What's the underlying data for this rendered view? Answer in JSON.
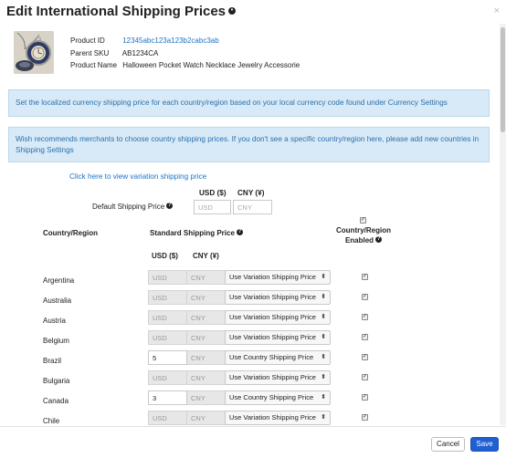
{
  "modal": {
    "title": "Edit International Shipping Prices",
    "close_glyph": "×",
    "help_icon": "info-circle-icon"
  },
  "product": {
    "id_label": "Product ID",
    "id_value": "12345abc123a123b2cabc3ab",
    "parent_sku_label": "Parent SKU",
    "parent_sku_value": "AB1234CA",
    "name_label": "Product Name",
    "name_value": "Halloween Pocket Watch Necklace Jewelry Accessorie"
  },
  "alerts": {
    "currency_notice": "Set the localized currency shipping price for each country/region based on your local currency code found under Currency Settings",
    "recommend_notice": "Wish recommends merchants to choose country shipping prices. If you don't see a specific country/region here, please add new countries in Shipping Settings"
  },
  "variation_link": "Click here to view variation shipping price",
  "default_price": {
    "label": "Default Shipping Price",
    "usd_header": "USD ($)",
    "cny_header": "CNY (¥)",
    "usd_placeholder": "USD",
    "cny_placeholder": "CNY"
  },
  "table": {
    "col_country": "Country/Region",
    "col_standard": "Standard Shipping Price",
    "col_enabled": "Country/Region Enabled",
    "usd_header": "USD ($)",
    "cny_header": "CNY (¥)",
    "rows": [
      {
        "country": "Argentina",
        "usd_value": "",
        "usd_placeholder": "USD",
        "cny_placeholder": "CNY",
        "option": "Use Variation Shipping Price",
        "enabled": true
      },
      {
        "country": "Australia",
        "usd_value": "",
        "usd_placeholder": "USD",
        "cny_placeholder": "CNY",
        "option": "Use Variation Shipping Price",
        "enabled": true
      },
      {
        "country": "Austria",
        "usd_value": "",
        "usd_placeholder": "USD",
        "cny_placeholder": "CNY",
        "option": "Use Variation Shipping Price",
        "enabled": true
      },
      {
        "country": "Belgium",
        "usd_value": "",
        "usd_placeholder": "USD",
        "cny_placeholder": "CNY",
        "option": "Use Variation Shipping Price",
        "enabled": true
      },
      {
        "country": "Brazil",
        "usd_value": "5",
        "usd_placeholder": "USD",
        "cny_placeholder": "CNY",
        "option": "Use Country Shipping Price",
        "enabled": true
      },
      {
        "country": "Bulgaria",
        "usd_value": "",
        "usd_placeholder": "USD",
        "cny_placeholder": "CNY",
        "option": "Use Variation Shipping Price",
        "enabled": true
      },
      {
        "country": "Canada",
        "usd_value": "3",
        "usd_placeholder": "USD",
        "cny_placeholder": "CNY",
        "option": "Use Country Shipping Price",
        "enabled": true
      },
      {
        "country": "Chile",
        "usd_value": "",
        "usd_placeholder": "USD",
        "cny_placeholder": "CNY",
        "option": "Use Variation Shipping Price",
        "enabled": true
      }
    ]
  },
  "footer": {
    "cancel_label": "Cancel",
    "save_label": "Save"
  },
  "colors": {
    "link": "#1a73c9",
    "alert_bg": "#d8eaf7",
    "alert_text": "#2a6fab",
    "primary_button": "#1f5fcf"
  }
}
